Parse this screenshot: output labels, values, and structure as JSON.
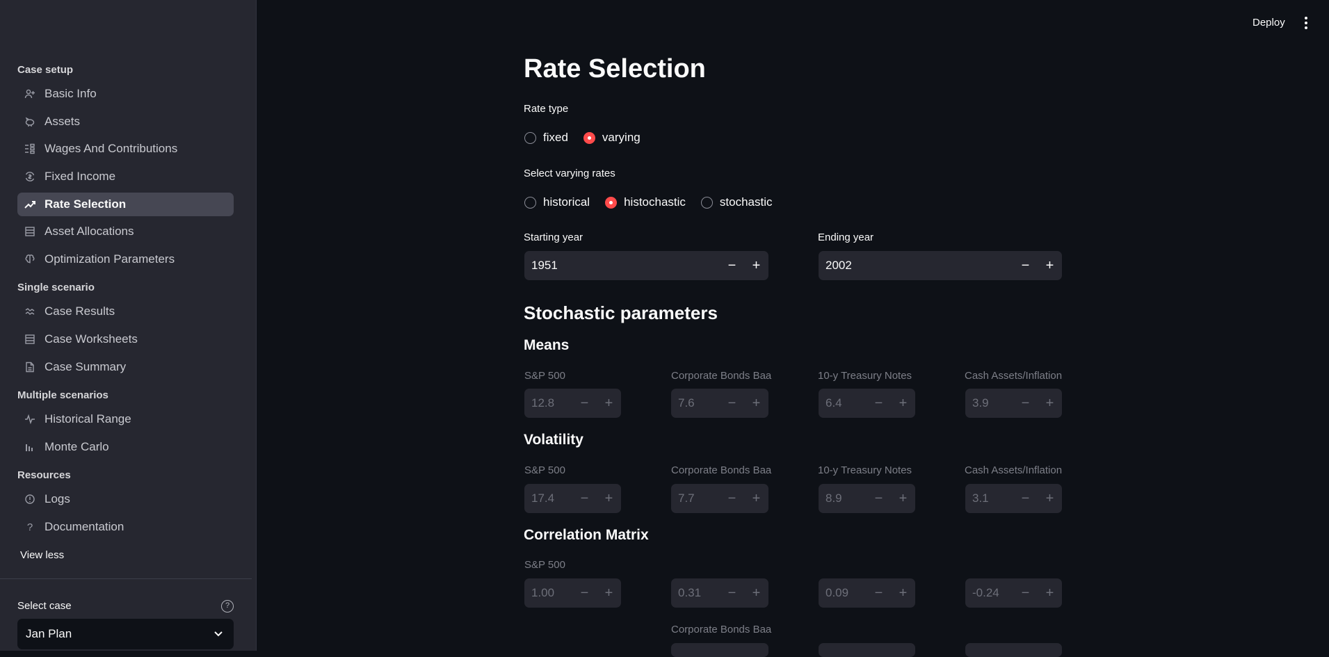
{
  "header": {
    "deploy_label": "Deploy",
    "menu_icon": "kebab-icon"
  },
  "sidebar": {
    "sections": [
      {
        "label": "Case setup"
      },
      {
        "label": "Single scenario"
      },
      {
        "label": "Multiple scenarios"
      },
      {
        "label": "Resources"
      }
    ],
    "items": [
      {
        "label": "Basic Info",
        "icon": "person-add-icon"
      },
      {
        "label": "Assets",
        "icon": "piggy-bank-icon"
      },
      {
        "label": "Wages And Contributions",
        "icon": "list-icon"
      },
      {
        "label": "Fixed Income",
        "icon": "currency-exchange-icon"
      },
      {
        "label": "Rate Selection",
        "icon": "trending-up-icon",
        "active": true
      },
      {
        "label": "Asset Allocations",
        "icon": "table-icon"
      },
      {
        "label": "Optimization Parameters",
        "icon": "brain-icon"
      },
      {
        "label": "Case Results",
        "icon": "stacked-line-icon"
      },
      {
        "label": "Case Worksheets",
        "icon": "table-icon"
      },
      {
        "label": "Case Summary",
        "icon": "document-icon"
      },
      {
        "label": "Historical Range",
        "icon": "pulse-icon"
      },
      {
        "label": "Monte Carlo",
        "icon": "bar-chart-icon"
      },
      {
        "label": "Logs",
        "icon": "info-circle-icon"
      },
      {
        "label": "Documentation",
        "icon": "question-icon"
      }
    ],
    "view_less": "View less",
    "select_case": {
      "label": "Select case",
      "value": "Jan Plan"
    }
  },
  "main": {
    "title": "Rate Selection",
    "rate_type": {
      "label": "Rate type",
      "options": [
        "fixed",
        "varying"
      ],
      "selected": "varying"
    },
    "varying_rates": {
      "label": "Select varying rates",
      "options": [
        "historical",
        "histochastic",
        "stochastic"
      ],
      "selected": "histochastic"
    },
    "starting_year": {
      "label": "Starting year",
      "value": "1951"
    },
    "ending_year": {
      "label": "Ending year",
      "value": "2002"
    },
    "stochastic_title": "Stochastic parameters",
    "means": {
      "title": "Means",
      "fields": [
        {
          "label": "S&P 500",
          "value": "12.8"
        },
        {
          "label": "Corporate Bonds Baa",
          "value": "7.6"
        },
        {
          "label": "10-y Treasury Notes",
          "value": "6.4"
        },
        {
          "label": "Cash Assets/Inflation",
          "value": "3.9"
        }
      ]
    },
    "volatility": {
      "title": "Volatility",
      "fields": [
        {
          "label": "S&P 500",
          "value": "17.4"
        },
        {
          "label": "Corporate Bonds Baa",
          "value": "7.7"
        },
        {
          "label": "10-y Treasury Notes",
          "value": "8.9"
        },
        {
          "label": "Cash Assets/Inflation",
          "value": "3.1"
        }
      ]
    },
    "correlation": {
      "title": "Correlation Matrix",
      "row1_label": "S&P 500",
      "row1_values": [
        "1.00",
        "0.31",
        "0.09",
        "-0.24"
      ],
      "row2_label": "Corporate Bonds Baa"
    },
    "minus": "−",
    "plus": "+"
  }
}
